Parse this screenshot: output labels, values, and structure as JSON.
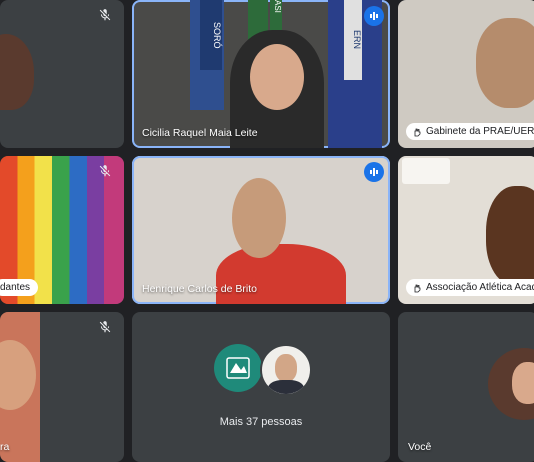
{
  "participants": [
    {
      "name": "Cicilia Raquel Maia Leite",
      "speaking": true
    },
    {
      "name": "Gabinete da PRAE/UERN"
    },
    {
      "name": "dantes"
    },
    {
      "name": "Henrique Carlos de Brito",
      "speaking": true,
      "active": true
    },
    {
      "name": "Associação Atlética Acadê"
    },
    {
      "name": "ra"
    },
    {
      "name": "Você"
    }
  ],
  "overflow": {
    "label": "Mais 37 pessoas"
  },
  "banners": {
    "left": "SORÓ",
    "mid": "ASI",
    "right": "ERN"
  },
  "colors": {
    "tile": "#3c4043",
    "speaking": "#1a73e8",
    "active_border": "#8ab4f8"
  }
}
